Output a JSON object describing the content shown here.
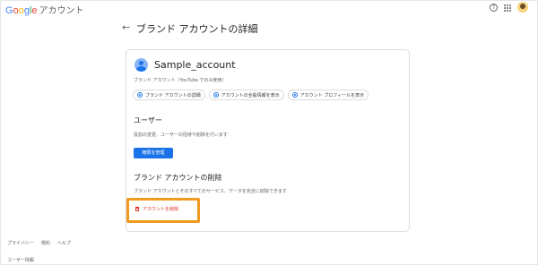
{
  "header": {
    "logo_letters": [
      "G",
      "o",
      "o",
      "g",
      "l",
      "e"
    ],
    "product": "アカウント",
    "help_icon": "help-circle-icon",
    "apps_icon": "apps-grid-icon",
    "avatar_icon": "user-avatar-icon"
  },
  "page": {
    "back_icon": "←",
    "title": "ブランド アカウントの詳細"
  },
  "account": {
    "name": "Sample_account",
    "subtitle": "ブランド アカウント（YouTube でのみ使用）",
    "chips": [
      {
        "label": "ブランド アカウントの詳細"
      },
      {
        "label": "アカウントの全般情報を表示"
      },
      {
        "label": "アカウント プロフィールを表示"
      }
    ]
  },
  "users_section": {
    "title": "ユーザー",
    "description": "役割の変更、ユーザーの招待や削除を行います",
    "button_label": "権限を管理"
  },
  "delete_section": {
    "title": "ブランド アカウントの削除",
    "description": "ブランド アカウントとそのすべてのサービス、データを完全に削除できます",
    "button_label": "アカウントを削除"
  },
  "footer": {
    "links": [
      "プライバシー",
      "規約",
      "ヘルプ"
    ],
    "extra": "ユーザー情報"
  },
  "colors": {
    "accent": "#1a73e8",
    "danger": "#d93025",
    "highlight": "#f29a1f"
  }
}
